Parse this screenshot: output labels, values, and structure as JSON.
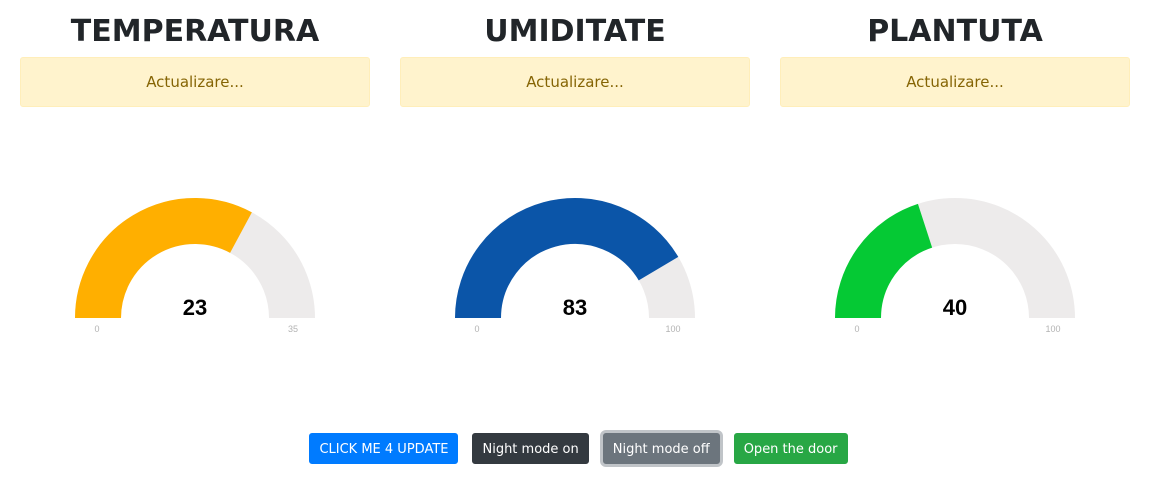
{
  "columns": [
    {
      "title": "TEMPERATURA",
      "status": "Actualizare...",
      "gauge": {
        "value": 23,
        "min": 0,
        "max": 35,
        "color": "#ffaf00",
        "track_color": "#edebeb"
      }
    },
    {
      "title": "UMIDITATE",
      "status": "Actualizare...",
      "gauge": {
        "value": 83,
        "min": 0,
        "max": 100,
        "color": "#0b55a8",
        "track_color": "#edebeb"
      }
    },
    {
      "title": "PLANTUTA",
      "status": "Actualizare...",
      "gauge": {
        "value": 40,
        "min": 0,
        "max": 100,
        "color": "#05c934",
        "track_color": "#edebeb"
      }
    }
  ],
  "buttons": {
    "update": "CLICK ME 4 UPDATE",
    "night_on": "Night mode on",
    "night_off": "Night mode off",
    "open_door": "Open the door"
  },
  "colors": {
    "primary": "#007bff",
    "dark": "#343a40",
    "secondary": "#6c757d",
    "success": "#28a745",
    "warning_bg": "#fff3cd",
    "warning_text": "#856404"
  }
}
